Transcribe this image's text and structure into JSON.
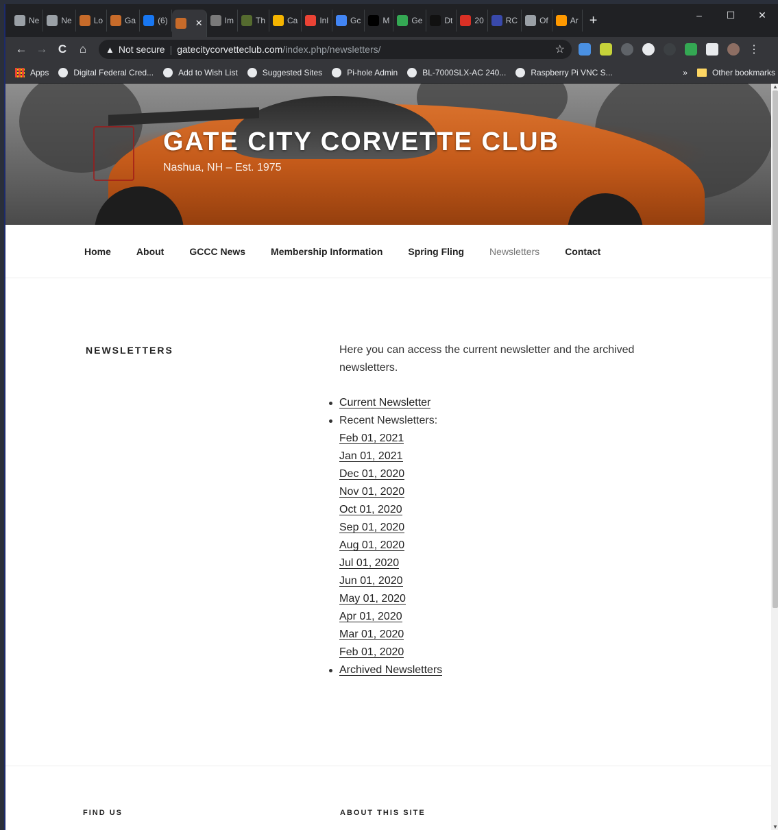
{
  "browser": {
    "tabs": [
      {
        "label": "Ne",
        "icon": "tab-favicon-icon",
        "color": "#9aa0a6"
      },
      {
        "label": "Ne",
        "icon": "tab-favicon-icon",
        "color": "#9aa0a6"
      },
      {
        "label": "Lo",
        "icon": "tab-favicon-icon",
        "color": "#c76b2a"
      },
      {
        "label": "Ga",
        "icon": "tab-favicon-icon",
        "color": "#c76b2a"
      },
      {
        "label": "(6)",
        "icon": "facebook-icon",
        "color": "#1877f2"
      },
      {
        "label": "",
        "icon": "tab-favicon-icon",
        "color": "#c76b2a",
        "active": true
      },
      {
        "label": "Im",
        "icon": "tab-favicon-icon",
        "color": "#7a7a7a"
      },
      {
        "label": "Th",
        "icon": "tab-favicon-icon",
        "color": "#556b2f"
      },
      {
        "label": "Ca",
        "icon": "tab-favicon-icon",
        "color": "#f4b400"
      },
      {
        "label": "Inl",
        "icon": "gmail-icon",
        "color": "#ea4335"
      },
      {
        "label": "Gc",
        "icon": "calendar-icon",
        "color": "#4285f4"
      },
      {
        "label": "M",
        "icon": "x-icon",
        "color": "#000000"
      },
      {
        "label": "Ge",
        "icon": "tab-favicon-icon",
        "color": "#34a853"
      },
      {
        "label": "Dt",
        "icon": "tab-favicon-icon",
        "color": "#111111"
      },
      {
        "label": "20",
        "icon": "tab-favicon-icon",
        "color": "#d93025"
      },
      {
        "label": "RC",
        "icon": "tab-favicon-icon",
        "color": "#3949ab"
      },
      {
        "label": "Of",
        "icon": "tab-favicon-icon",
        "color": "#9aa0a6"
      },
      {
        "label": "Ar",
        "icon": "amazon-icon",
        "color": "#ff9900"
      }
    ],
    "active_tab_close": "✕",
    "new_tab": "+",
    "window_controls": {
      "minimize": "–",
      "maximize": "☐",
      "close": "✕"
    },
    "nav": {
      "back": "←",
      "forward": "→",
      "reload": "C",
      "home": "⌂"
    },
    "address": {
      "warning": "▲",
      "security_label": "Not secure",
      "host": "gatecitycorvetteclub.com",
      "path": "/index.php/newsletters/",
      "star": "☆"
    },
    "bookmarks": [
      {
        "label": "Apps",
        "icon": "apps-grid-icon"
      },
      {
        "label": "Digital Federal Cred...",
        "icon": "globe-icon"
      },
      {
        "label": "Add to Wish List",
        "icon": "globe-icon"
      },
      {
        "label": "Suggested Sites",
        "icon": "globe-icon"
      },
      {
        "label": "Pi-hole Admin",
        "icon": "pihole-icon"
      },
      {
        "label": "BL-7000SLX-AC 240...",
        "icon": "bookmark-site-icon"
      },
      {
        "label": "Raspberry Pi VNC S...",
        "icon": "globe-icon"
      }
    ],
    "bookmarks_more": "»",
    "other_bookmarks": "Other bookmarks"
  },
  "site": {
    "title": "GATE CITY CORVETTE CLUB",
    "description": "Nashua, NH – Est. 1975",
    "nav": [
      {
        "label": "Home",
        "current": false
      },
      {
        "label": "About",
        "current": false
      },
      {
        "label": "GCCC News",
        "current": false
      },
      {
        "label": "Membership Information",
        "current": false
      },
      {
        "label": "Spring Fling",
        "current": false
      },
      {
        "label": "Newsletters",
        "current": true
      },
      {
        "label": "Contact",
        "current": false
      }
    ]
  },
  "page": {
    "title": "NEWSLETTERS",
    "intro": "Here you can access the current newsletter and the archived newsletters.",
    "current_newsletter": "Current Newsletter",
    "recent_label": "Recent Newsletters:",
    "recent": [
      "Feb 01, 2021",
      "Jan 01, 2021",
      "Dec 01, 2020",
      "Nov 01, 2020",
      "Oct 01, 2020",
      "Sep 01, 2020",
      "Aug 01, 2020",
      "Jul 01, 2020",
      "Jun 01, 2020",
      "May 01, 2020",
      "Apr 01, 2020",
      "Mar 01, 2020",
      "Feb 01, 2020"
    ],
    "archived": "Archived Newsletters"
  },
  "footer": {
    "find_us": "FIND US",
    "about_site": "ABOUT THIS SITE"
  }
}
